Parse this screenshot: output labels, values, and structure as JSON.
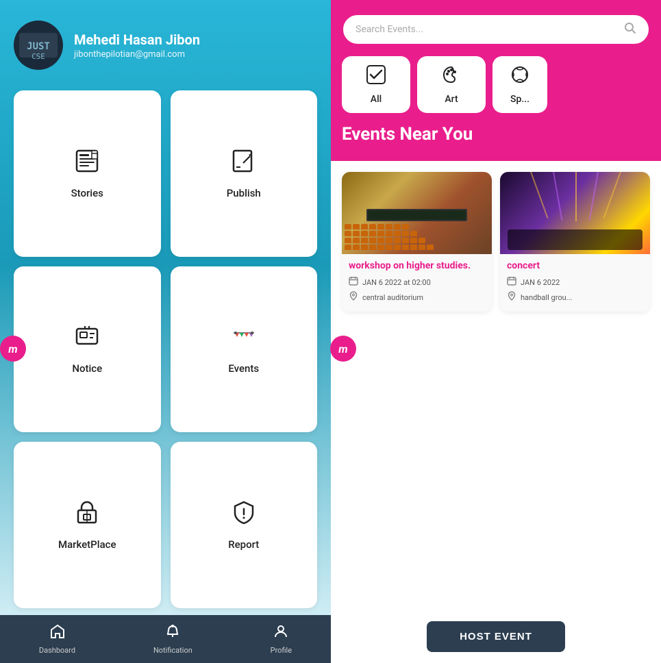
{
  "user": {
    "name": "Mehedi Hasan Jibon",
    "email": "jibonthepilotian@gmail.com"
  },
  "menu_cards": [
    {
      "id": "stories",
      "label": "Stories",
      "icon": "📰"
    },
    {
      "id": "publish",
      "label": "Publish",
      "icon": "✏️"
    },
    {
      "id": "notice",
      "label": "Notice",
      "icon": "🖼️"
    },
    {
      "id": "events",
      "label": "Events",
      "icon": "🎉"
    },
    {
      "id": "marketplace",
      "label": "MarketPlace",
      "icon": "🏪"
    },
    {
      "id": "report",
      "label": "Report",
      "icon": "🛡️"
    }
  ],
  "bottom_nav": [
    {
      "id": "dashboard",
      "label": "Dashboard",
      "icon": "🏠"
    },
    {
      "id": "notification",
      "label": "Notification",
      "icon": "🔔"
    },
    {
      "id": "profile",
      "label": "Profile",
      "icon": "👤"
    }
  ],
  "search": {
    "placeholder": "Search Events..."
  },
  "categories": [
    {
      "id": "all",
      "label": "All",
      "icon": "✅"
    },
    {
      "id": "art",
      "label": "Art",
      "icon": "🎭"
    },
    {
      "id": "sports",
      "label": "Sp...",
      "icon": "🏅"
    }
  ],
  "events_near_title": "Events Near You",
  "events": [
    {
      "id": "workshop",
      "title": "workshop on higher studies.",
      "date": "JAN 6 2022 at 02:00",
      "location": "central auditorium",
      "type": "lecture"
    },
    {
      "id": "concert",
      "title": "concert",
      "date": "JAN 6 2022",
      "location": "handball grou...",
      "type": "concert"
    }
  ],
  "host_event_btn": "HOST EVENT",
  "watermark_left": "m",
  "watermark_right": "m"
}
